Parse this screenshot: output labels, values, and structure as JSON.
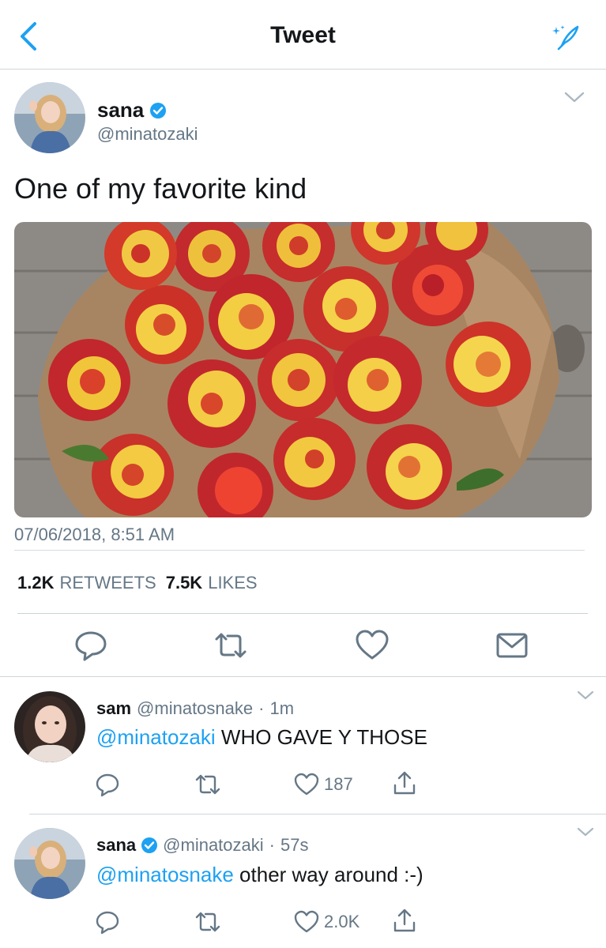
{
  "navbar": {
    "title": "Tweet",
    "back_icon": "chevron-left-icon",
    "compose_icon": "feather-sparkle-icon",
    "accent": "#1da1f2"
  },
  "tweet": {
    "name": "sana",
    "handle": "@minatozaki",
    "verified": true,
    "text": "One of my favorite kind",
    "image_subject": "bouquet of red and yellow roses on wood",
    "timestamp": "07/06/2018, 8:51 AM",
    "retweets_count": "1.2K",
    "retweets_label": "RETWEETS",
    "likes_count": "7.5K",
    "likes_label": "LIKES",
    "actions": [
      "reply-icon",
      "retweet-icon",
      "heart-icon",
      "mail-icon"
    ]
  },
  "replies": [
    {
      "name": "sam",
      "handle": "@minatosnake",
      "time": "1m",
      "verified": false,
      "mention": "@minatozaki",
      "text": "WHO GAVE Y THOSE",
      "likes": "187"
    },
    {
      "name": "sana",
      "handle": "@minatozaki",
      "time": "57s",
      "verified": true,
      "mention": "@minatosnake",
      "text": "other way around :-)",
      "likes": "2.0K"
    }
  ],
  "colors": {
    "text": "#14171a",
    "secondary": "#657786",
    "link": "#1da1f2",
    "divider": "#cfd6dc"
  }
}
